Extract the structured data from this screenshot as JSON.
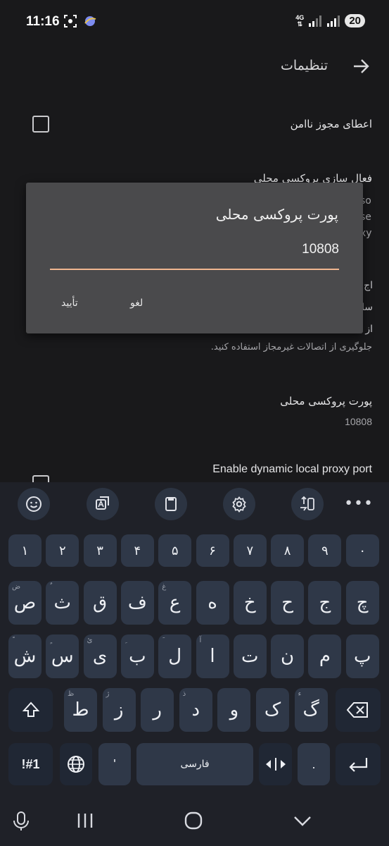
{
  "status_bar": {
    "time": "11:16",
    "network": "4G",
    "battery": "20"
  },
  "app_bar": {
    "title": "تنظیمات"
  },
  "settings": {
    "insecure": {
      "title": "اعطای مجوز ناامن"
    },
    "local_proxy": {
      "title": "فعال سازی پروکسی محلی",
      "desc_fragments": [
        "so",
        "se",
        "xy"
      ]
    },
    "auth": {
      "fragments": [
        "اج",
        "سا",
        "از"
      ],
      "desc": "جلوگیری از اتصالات غیرمجاز استفاده کنید."
    },
    "proxy_port": {
      "title": "پورت پروکسی محلی",
      "value": "10808"
    },
    "dynamic_port": {
      "title": "Enable dynamic local proxy port"
    }
  },
  "dialog": {
    "title": "پورت پروکسی محلی",
    "input_value": "10808",
    "confirm": "تأیید",
    "cancel": "لغو"
  },
  "keyboard": {
    "toolbar": [
      "emoji-icon",
      "translate-icon",
      "clipboard-icon",
      "gear-icon",
      "mode-switch-icon"
    ],
    "more": "•••",
    "numbers": [
      "۱",
      "۲",
      "۳",
      "۴",
      "۵",
      "۶",
      "۷",
      "۸",
      "۹",
      "۰"
    ],
    "row1": [
      {
        "k": "ص",
        "h": "ض"
      },
      {
        "k": "ث",
        "h": "ٌ"
      },
      {
        "k": "ق",
        "h": ""
      },
      {
        "k": "ف",
        "h": ""
      },
      {
        "k": "ع",
        "h": "غ"
      },
      {
        "k": "ه",
        "h": ""
      },
      {
        "k": "خ",
        "h": ""
      },
      {
        "k": "ح",
        "h": ""
      },
      {
        "k": "ج",
        "h": ""
      },
      {
        "k": "چ",
        "h": ""
      }
    ],
    "row2": [
      {
        "k": "ش",
        "h": "ً"
      },
      {
        "k": "س",
        "h": "ٍ"
      },
      {
        "k": "ی",
        "h": "ئ"
      },
      {
        "k": "ب",
        "h": "ِ"
      },
      {
        "k": "ل",
        "h": "َ"
      },
      {
        "k": "ا",
        "h": "آ"
      },
      {
        "k": "ت",
        "h": ""
      },
      {
        "k": "ن",
        "h": ""
      },
      {
        "k": "م",
        "h": ""
      },
      {
        "k": "پ",
        "h": ""
      }
    ],
    "row3": [
      {
        "k": "ط",
        "h": "ظ"
      },
      {
        "k": "ز",
        "h": "ژ"
      },
      {
        "k": "ر",
        "h": ""
      },
      {
        "k": "د",
        "h": "ذ"
      },
      {
        "k": "و",
        "h": ""
      },
      {
        "k": "ک",
        "h": ""
      },
      {
        "k": "گ",
        "h": "ء"
      }
    ],
    "symbols": "!#1",
    "comma": "'",
    "space": "فارسی",
    "period": "."
  }
}
